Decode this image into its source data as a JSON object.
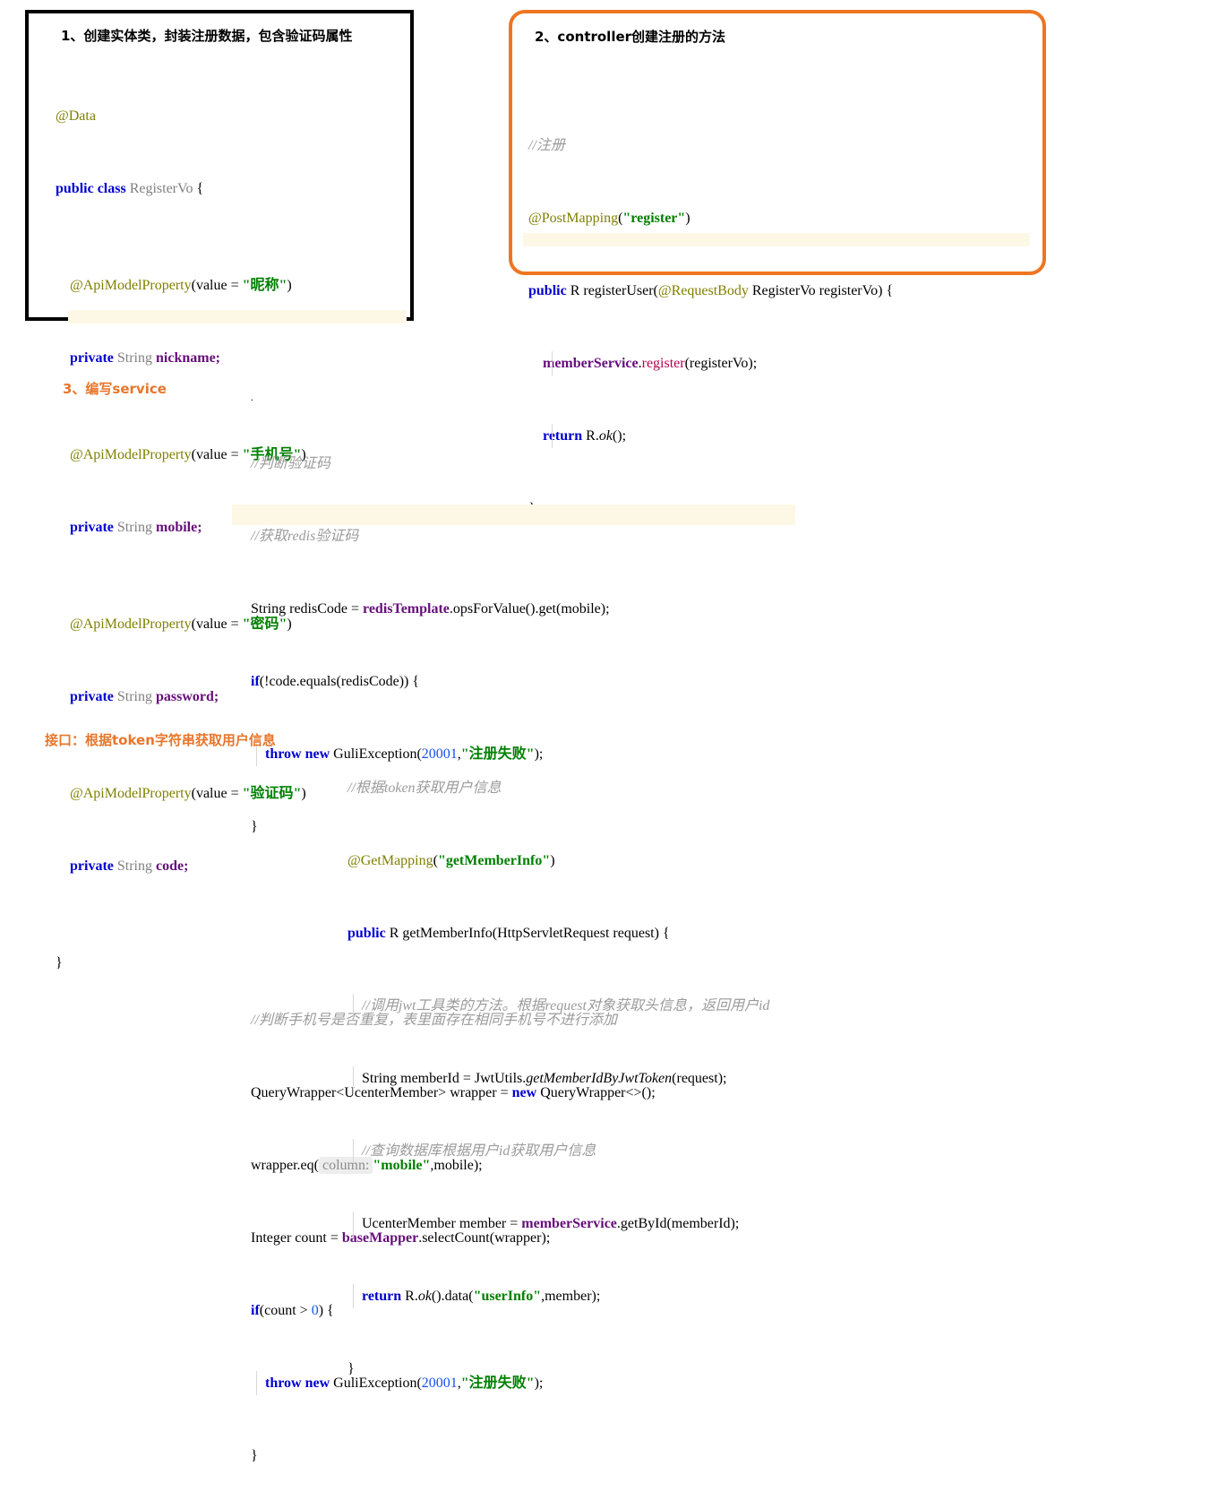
{
  "box1": {
    "title": "1、创建实体类，封装注册数据，包含验证码属性",
    "lines": {
      "l1": "@Data",
      "l2a": "public class",
      "l2b": " RegisterVo",
      "l2c": " {",
      "l3a": "    @ApiModelProperty",
      "l3b": "(value = ",
      "l3c": "\"昵称\"",
      "l3d": ")",
      "l4a": "    private",
      "l4b": " String ",
      "l4c": "nickname",
      "l4d": ";",
      "l5c": "\"手机号\"",
      "l6c": "mobile",
      "l7c": "\"密码\"",
      "l8c": "password",
      "l9c": "\"验证码\"",
      "l10c": "code",
      "l11": "}"
    }
  },
  "box2": {
    "title": "2、controller创建注册的方法",
    "lines": {
      "c1": "//注册",
      "c2a": "@PostMapping",
      "c2b": "(",
      "c2c": "\"register\"",
      "c2d": ")",
      "c3a": "public",
      "c3b": " R registerUser(",
      "c3c": "@RequestBody",
      "c3d": " RegisterVo registerVo) {",
      "c4a": "    memberService",
      "c4b": ".",
      "c4c": "register",
      "c4d": "(registerVo);",
      "c5a": "    return",
      "c5b": " R.",
      "c5c": "ok",
      "c5d": "();",
      "c6": "}"
    }
  },
  "section3": {
    "label": "3、编写service",
    "lines": {
      "dot": ".",
      "s1": "//判断验证码",
      "s2": "//获取redis验证码",
      "s3a": "String redisCode = ",
      "s3b": "redisTemplate",
      "s3c": ".opsForValue().get(mobile);",
      "s4a": "if",
      "s4b": "(!code.equals(redisCode)) {",
      "s5a": "    throw new",
      "s5b": " GuliException(",
      "s5c": "20001",
      "s5d": ",",
      "s5e": "\"注册失败\"",
      "s5f": ");",
      "s6": "}",
      "s7": "//判断手机号是否重复，表里面存在相同手机号不进行添加",
      "s8a": "QueryWrapper<UcenterMember> wrapper = ",
      "s8b": "new",
      "s8c": " QueryWrapper<>();",
      "s9a": "wrapper.eq(",
      "s9hint": "column:",
      "s9b": "\"mobile\"",
      "s9c": ",mobile);",
      "s10a": "Integer count = ",
      "s10b": "baseMapper",
      "s10c": ".selectCount(wrapper);",
      "s11a": "if",
      "s11b": "(count ",
      "s11c": "> ",
      "s11d": "0",
      "s11e": ") {",
      "s12a": "    throw new",
      "s12b": " GuliException(",
      "s12c": "20001",
      "s12d": ",",
      "s12e": "\"注册失败\"",
      "s12f": ");",
      "s13": "}"
    }
  },
  "section4": {
    "label": "接口：根据token字符串获取用户信息",
    "lines": {
      "t1": "//根据token获取用户信息",
      "t2a": "@GetMapping",
      "t2b": "(",
      "t2c": "\"getMemberInfo\"",
      "t2d": ")",
      "t3a": "public",
      "t3b": " R getMemberInfo(HttpServletRequest request) {",
      "t4": "    //调用jwt工具类的方法。根据request对象获取头信息，返回用户id",
      "t5a": "    String memberId = JwtUtils.",
      "t5b": "getMemberIdByJwtToken",
      "t5c": "(request);",
      "t6": "    //查询数据库根据用户id获取用户信息",
      "t7a": "    UcenterMember member = ",
      "t7b": "memberService",
      "t7c": ".getById(memberId);",
      "t8a": "    return",
      "t8b": " R.",
      "t8c": "ok",
      "t8d": "().data(",
      "t8e": "\"userInfo\"",
      "t8f": ",member);",
      "t9": "}"
    }
  },
  "colors": {
    "keyword": "#0000d0",
    "annotation": "#808000",
    "string": "#008000",
    "comment": "#9b9b9b",
    "field": "#660e7a",
    "number": "#1750eb",
    "method_call": "#b5004f",
    "box1_border": "#000000",
    "box2_border": "#ef7521",
    "heading_orange": "#e8762b",
    "highlight_band": "#fdf8e6",
    "inlay_hint_bg": "#ededed"
  }
}
